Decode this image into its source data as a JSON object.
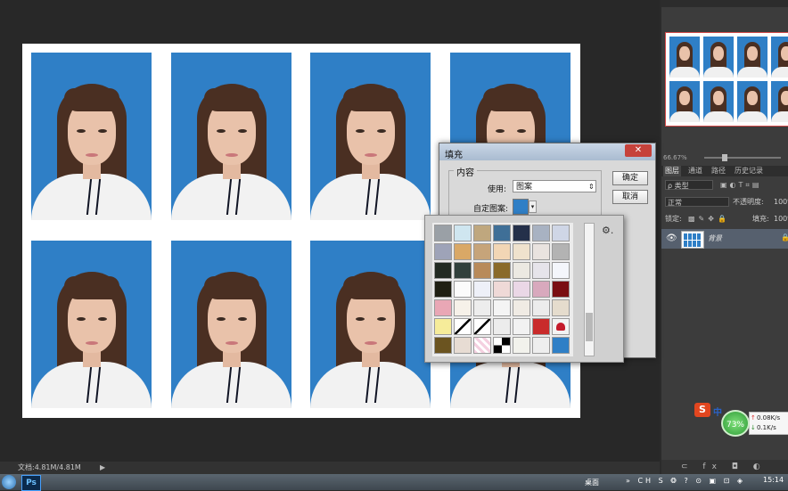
{
  "dialog": {
    "title": "填充",
    "content_group": "内容",
    "use_label": "使用:",
    "use_value": "图案",
    "custom_pattern_label": "自定图案:",
    "ok": "确定",
    "cancel": "取消",
    "close_symbol": "✕"
  },
  "status": {
    "doc_size": "文档:4.81M/4.81M",
    "arrow": "▶"
  },
  "navigator": {
    "zoom": "66.67%"
  },
  "layers_panel": {
    "tabs": [
      "图层",
      "通道",
      "路径",
      "历史记录"
    ],
    "kind": "ρ 类型",
    "filter_icons": "▣◐T⌗▤",
    "blend_mode": "正常",
    "opacity_label": "不透明度:",
    "opacity_value": "100%",
    "lock_label": "锁定:",
    "lock_icons": "▩✎✥🔒",
    "fill_label": "填充:",
    "fill_value": "100%",
    "layer_name": "背景",
    "bottom_icons": "⊂ fx ◘ ◐ ▭ ▢ 🗑"
  },
  "picker": {
    "gear": "⚙."
  },
  "taskbar": {
    "ps_label": "Ps",
    "desktop": "桌面",
    "tray": "» CH S ❂ ? ⊙ ▣ ⊡ ◈",
    "clock": "15:14"
  },
  "widget": {
    "ime_icon": "S",
    "ime_text": "中",
    "net_percent": "73%",
    "up_arrow": "↑",
    "down_arrow": "↓",
    "up_speed": "0.08K/s",
    "down_speed": "0.1K/s"
  }
}
